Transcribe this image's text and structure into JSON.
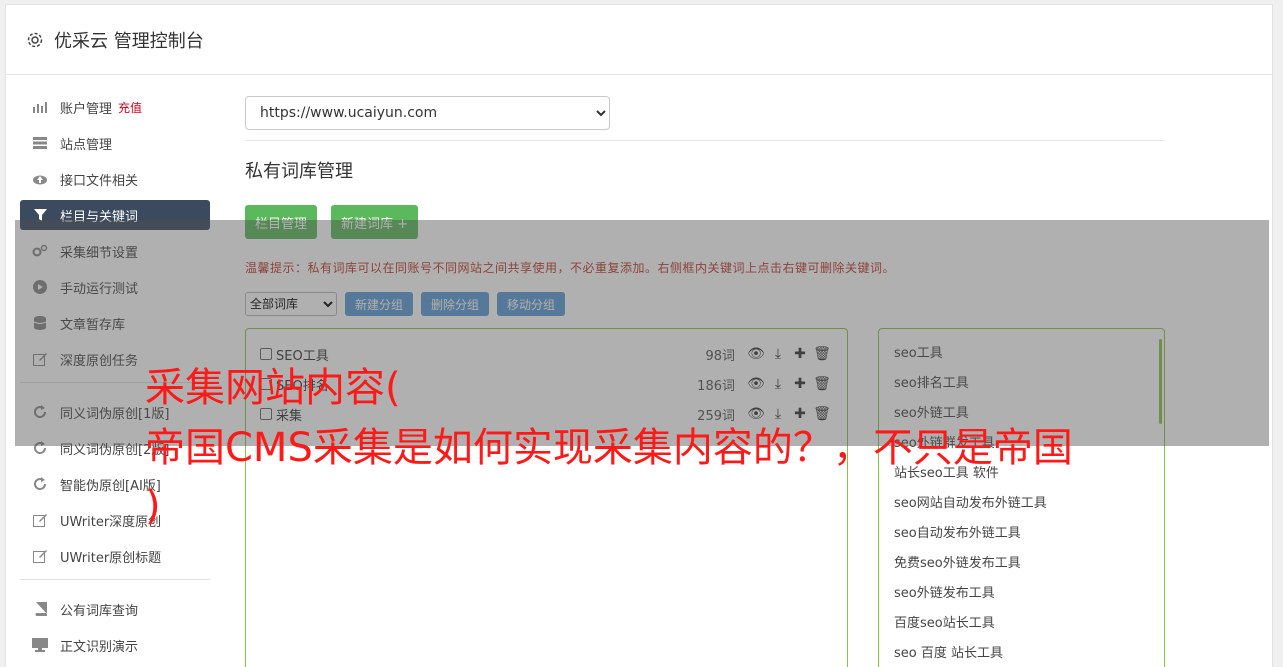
{
  "header": {
    "title": "优采云 管理控制台",
    "icon": "gear-icon"
  },
  "sidebar": {
    "group1": [
      {
        "label": "账户管理",
        "badge": "充值",
        "icon": "bar-chart-icon"
      },
      {
        "label": "站点管理",
        "icon": "server-icon"
      },
      {
        "label": "接口文件相关",
        "icon": "cloud-upload-icon"
      },
      {
        "label": "栏目与关键词",
        "icon": "filter-icon",
        "active": true
      },
      {
        "label": "采集细节设置",
        "icon": "cogs-icon"
      },
      {
        "label": "手动运行测试",
        "icon": "play-icon"
      },
      {
        "label": "文章暂存库",
        "icon": "database-icon"
      },
      {
        "label": "深度原创任务",
        "icon": "edit-icon"
      }
    ],
    "group2": [
      {
        "label": "同义词伪原创[1版]",
        "icon": "refresh-icon"
      },
      {
        "label": "同义词伪原创[2版]",
        "icon": "refresh-icon"
      },
      {
        "label": "智能伪原创[AI版]",
        "icon": "refresh-icon"
      },
      {
        "label": "UWriter深度原创",
        "icon": "edit-icon"
      },
      {
        "label": "UWriter原创标题",
        "icon": "edit-icon"
      }
    ],
    "group3": [
      {
        "label": "公有词库查询",
        "icon": "book-icon"
      },
      {
        "label": "正文识别演示",
        "icon": "monitor-icon"
      }
    ]
  },
  "main": {
    "site_select": "https://www.ucaiyun.com",
    "section_title": "私有词库管理",
    "btn_column": "栏目管理",
    "btn_new_lib": "新建词库 +",
    "tip": "温馨提示：私有词库可以在同账号不同网站之间共享使用，不必重复添加。右侧框内关键词上点击右键可删除关键词。",
    "group_select": "全部词库",
    "btn_new_group": "新建分组",
    "btn_delete_group": "删除分组",
    "btn_move_group": "移动分组",
    "libraries": [
      {
        "name": "SEO工具",
        "count": "98词"
      },
      {
        "name": "SEO排名",
        "count": "186词"
      },
      {
        "name": "采集",
        "count": "259词"
      }
    ],
    "keywords": [
      "seo工具",
      "seo排名工具",
      "seo外链工具",
      "seo外链群发工具",
      "站长seo工具 软件",
      "seo网站自动发布外链工具",
      "seo自动发布外链工具",
      "免费seo外链发布工具",
      "seo外链发布工具",
      "百度seo站长工具",
      "seo 百度 站长工具"
    ]
  },
  "watermark": {
    "line1": "采集网站内容(",
    "line2": "帝国CMS采集是如何实现采集内容的？，不只是帝国",
    "line3": ")"
  }
}
